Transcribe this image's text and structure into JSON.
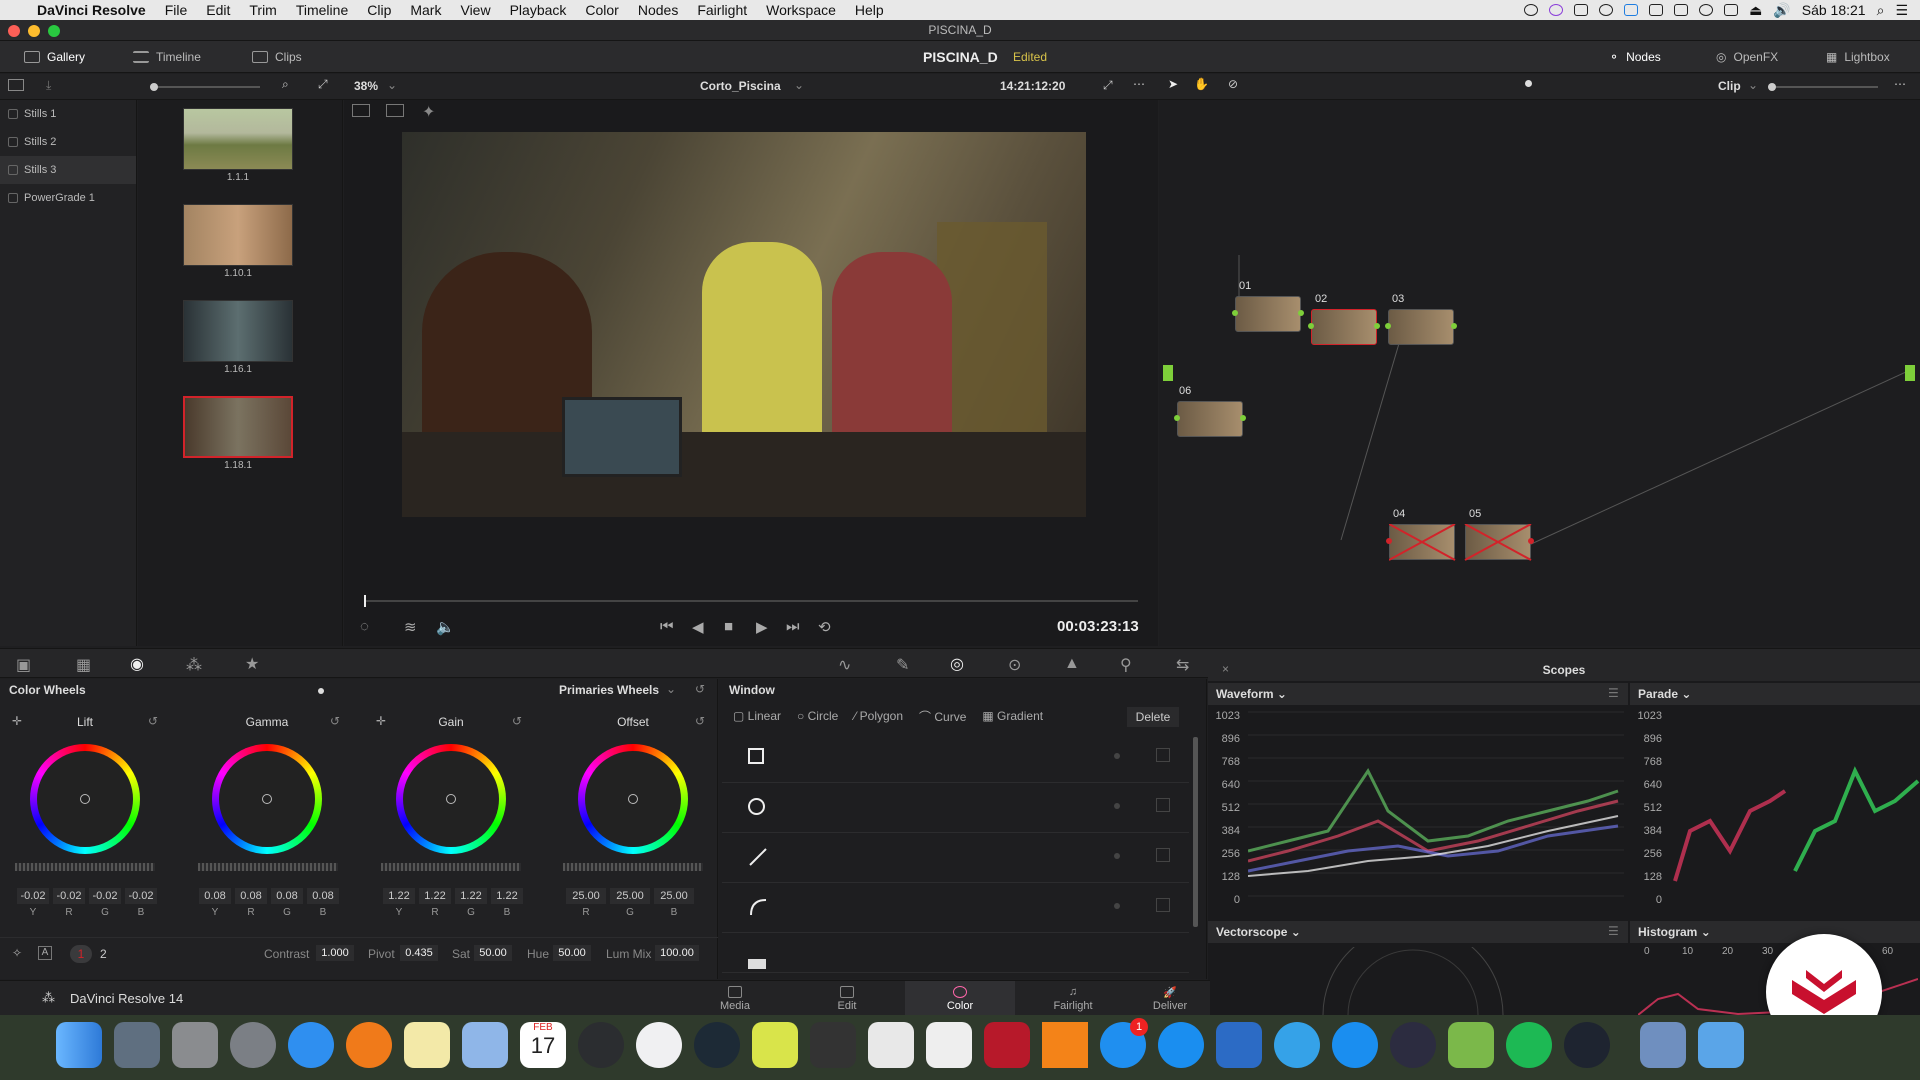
{
  "menubar": {
    "app_name": "DaVinci Resolve",
    "items": [
      "File",
      "Edit",
      "Trim",
      "Timeline",
      "Clip",
      "Mark",
      "View",
      "Playback",
      "Color",
      "Nodes",
      "Fairlight",
      "Workspace",
      "Help"
    ],
    "clock": "Sáb 18:21"
  },
  "window": {
    "title": "PISCINA_D"
  },
  "topbar": {
    "gallery": "Gallery",
    "timeline": "Timeline",
    "clips": "Clips",
    "project": "PISCINA_D",
    "status": "Edited",
    "nodes": "Nodes",
    "openfx": "OpenFX",
    "lightbox": "Lightbox"
  },
  "toolrow": {
    "zoom": "38%",
    "clip_name": "Corto_Piscina",
    "timecode": "14:21:12:20",
    "node_mode": "Clip"
  },
  "gallery": {
    "albums": [
      "Stills 1",
      "Stills 2",
      "Stills 3",
      "PowerGrade 1"
    ],
    "selected_album": 2,
    "stills": [
      "1.1.1",
      "1.10.1",
      "1.16.1",
      "1.18.1"
    ],
    "selected_still": 3
  },
  "viewer": {
    "playhead_timecode": "00:03:23:13"
  },
  "nodes": {
    "labels": [
      "01",
      "02",
      "03",
      "06",
      "04",
      "05"
    ]
  },
  "color_wheels": {
    "panel_title": "Color Wheels",
    "mode": "Primaries Wheels",
    "wheels": [
      {
        "name": "Lift",
        "values": [
          "-0.02",
          "-0.02",
          "-0.02",
          "-0.02"
        ],
        "channels": [
          "Y",
          "R",
          "G",
          "B"
        ]
      },
      {
        "name": "Gamma",
        "values": [
          "0.08",
          "0.08",
          "0.08",
          "0.08"
        ],
        "channels": [
          "Y",
          "R",
          "G",
          "B"
        ]
      },
      {
        "name": "Gain",
        "values": [
          "1.22",
          "1.22",
          "1.22",
          "1.22"
        ],
        "channels": [
          "Y",
          "R",
          "G",
          "B"
        ]
      },
      {
        "name": "Offset",
        "values": [
          "25.00",
          "25.00",
          "25.00"
        ],
        "channels": [
          "R",
          "G",
          "B"
        ]
      }
    ],
    "pages": [
      "1",
      "2"
    ],
    "contrast_label": "Contrast",
    "contrast": "1.000",
    "pivot_label": "Pivot",
    "pivot": "0.435",
    "sat_label": "Sat",
    "sat": "50.00",
    "hue_label": "Hue",
    "hue": "50.00",
    "lummix_label": "Lum Mix",
    "lummix": "100.00"
  },
  "window_panel": {
    "title": "Window",
    "shapes": [
      "Linear",
      "Circle",
      "Polygon",
      "Curve",
      "Gradient"
    ],
    "delete": "Delete"
  },
  "scopes": {
    "title": "Scopes",
    "waveform": "Waveform",
    "parade": "Parade",
    "vectorscope": "Vectorscope",
    "histogram": "Histogram",
    "ticks": [
      "1023",
      "896",
      "768",
      "640",
      "512",
      "384",
      "256",
      "128",
      "0"
    ],
    "hist_ticks": [
      "0",
      "10",
      "20",
      "30",
      "40",
      "50",
      "60"
    ]
  },
  "status": {
    "product": "DaVinci Resolve 14",
    "pages": [
      "Media",
      "Edit",
      "Color",
      "Fairlight",
      "Deliver"
    ],
    "active_page": "Color"
  },
  "dock": {
    "calendar_month": "FEB",
    "calendar_day": "17",
    "badge": "1"
  },
  "colors": {
    "accent_red": "#d2232a",
    "edited_yellow": "#d8c34a",
    "node_green": "#7ecf3a"
  }
}
